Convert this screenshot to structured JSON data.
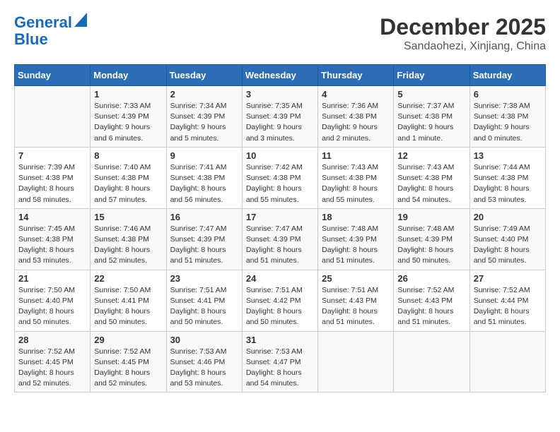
{
  "header": {
    "logo_line1": "General",
    "logo_line2": "Blue",
    "title": "December 2025",
    "subtitle": "Sandaohezi, Xinjiang, China"
  },
  "days_of_week": [
    "Sunday",
    "Monday",
    "Tuesday",
    "Wednesday",
    "Thursday",
    "Friday",
    "Saturday"
  ],
  "weeks": [
    [
      {
        "day": "",
        "info": ""
      },
      {
        "day": "1",
        "info": "Sunrise: 7:33 AM\nSunset: 4:39 PM\nDaylight: 9 hours\nand 6 minutes."
      },
      {
        "day": "2",
        "info": "Sunrise: 7:34 AM\nSunset: 4:39 PM\nDaylight: 9 hours\nand 5 minutes."
      },
      {
        "day": "3",
        "info": "Sunrise: 7:35 AM\nSunset: 4:39 PM\nDaylight: 9 hours\nand 3 minutes."
      },
      {
        "day": "4",
        "info": "Sunrise: 7:36 AM\nSunset: 4:38 PM\nDaylight: 9 hours\nand 2 minutes."
      },
      {
        "day": "5",
        "info": "Sunrise: 7:37 AM\nSunset: 4:38 PM\nDaylight: 9 hours\nand 1 minute."
      },
      {
        "day": "6",
        "info": "Sunrise: 7:38 AM\nSunset: 4:38 PM\nDaylight: 9 hours\nand 0 minutes."
      }
    ],
    [
      {
        "day": "7",
        "info": "Sunrise: 7:39 AM\nSunset: 4:38 PM\nDaylight: 8 hours\nand 58 minutes."
      },
      {
        "day": "8",
        "info": "Sunrise: 7:40 AM\nSunset: 4:38 PM\nDaylight: 8 hours\nand 57 minutes."
      },
      {
        "day": "9",
        "info": "Sunrise: 7:41 AM\nSunset: 4:38 PM\nDaylight: 8 hours\nand 56 minutes."
      },
      {
        "day": "10",
        "info": "Sunrise: 7:42 AM\nSunset: 4:38 PM\nDaylight: 8 hours\nand 55 minutes."
      },
      {
        "day": "11",
        "info": "Sunrise: 7:43 AM\nSunset: 4:38 PM\nDaylight: 8 hours\nand 55 minutes."
      },
      {
        "day": "12",
        "info": "Sunrise: 7:43 AM\nSunset: 4:38 PM\nDaylight: 8 hours\nand 54 minutes."
      },
      {
        "day": "13",
        "info": "Sunrise: 7:44 AM\nSunset: 4:38 PM\nDaylight: 8 hours\nand 53 minutes."
      }
    ],
    [
      {
        "day": "14",
        "info": "Sunrise: 7:45 AM\nSunset: 4:38 PM\nDaylight: 8 hours\nand 53 minutes."
      },
      {
        "day": "15",
        "info": "Sunrise: 7:46 AM\nSunset: 4:38 PM\nDaylight: 8 hours\nand 52 minutes."
      },
      {
        "day": "16",
        "info": "Sunrise: 7:47 AM\nSunset: 4:39 PM\nDaylight: 8 hours\nand 51 minutes."
      },
      {
        "day": "17",
        "info": "Sunrise: 7:47 AM\nSunset: 4:39 PM\nDaylight: 8 hours\nand 51 minutes."
      },
      {
        "day": "18",
        "info": "Sunrise: 7:48 AM\nSunset: 4:39 PM\nDaylight: 8 hours\nand 51 minutes."
      },
      {
        "day": "19",
        "info": "Sunrise: 7:48 AM\nSunset: 4:39 PM\nDaylight: 8 hours\nand 50 minutes."
      },
      {
        "day": "20",
        "info": "Sunrise: 7:49 AM\nSunset: 4:40 PM\nDaylight: 8 hours\nand 50 minutes."
      }
    ],
    [
      {
        "day": "21",
        "info": "Sunrise: 7:50 AM\nSunset: 4:40 PM\nDaylight: 8 hours\nand 50 minutes."
      },
      {
        "day": "22",
        "info": "Sunrise: 7:50 AM\nSunset: 4:41 PM\nDaylight: 8 hours\nand 50 minutes."
      },
      {
        "day": "23",
        "info": "Sunrise: 7:51 AM\nSunset: 4:41 PM\nDaylight: 8 hours\nand 50 minutes."
      },
      {
        "day": "24",
        "info": "Sunrise: 7:51 AM\nSunset: 4:42 PM\nDaylight: 8 hours\nand 50 minutes."
      },
      {
        "day": "25",
        "info": "Sunrise: 7:51 AM\nSunset: 4:43 PM\nDaylight: 8 hours\nand 51 minutes."
      },
      {
        "day": "26",
        "info": "Sunrise: 7:52 AM\nSunset: 4:43 PM\nDaylight: 8 hours\nand 51 minutes."
      },
      {
        "day": "27",
        "info": "Sunrise: 7:52 AM\nSunset: 4:44 PM\nDaylight: 8 hours\nand 51 minutes."
      }
    ],
    [
      {
        "day": "28",
        "info": "Sunrise: 7:52 AM\nSunset: 4:45 PM\nDaylight: 8 hours\nand 52 minutes."
      },
      {
        "day": "29",
        "info": "Sunrise: 7:52 AM\nSunset: 4:45 PM\nDaylight: 8 hours\nand 52 minutes."
      },
      {
        "day": "30",
        "info": "Sunrise: 7:53 AM\nSunset: 4:46 PM\nDaylight: 8 hours\nand 53 minutes."
      },
      {
        "day": "31",
        "info": "Sunrise: 7:53 AM\nSunset: 4:47 PM\nDaylight: 8 hours\nand 54 minutes."
      },
      {
        "day": "",
        "info": ""
      },
      {
        "day": "",
        "info": ""
      },
      {
        "day": "",
        "info": ""
      }
    ]
  ]
}
